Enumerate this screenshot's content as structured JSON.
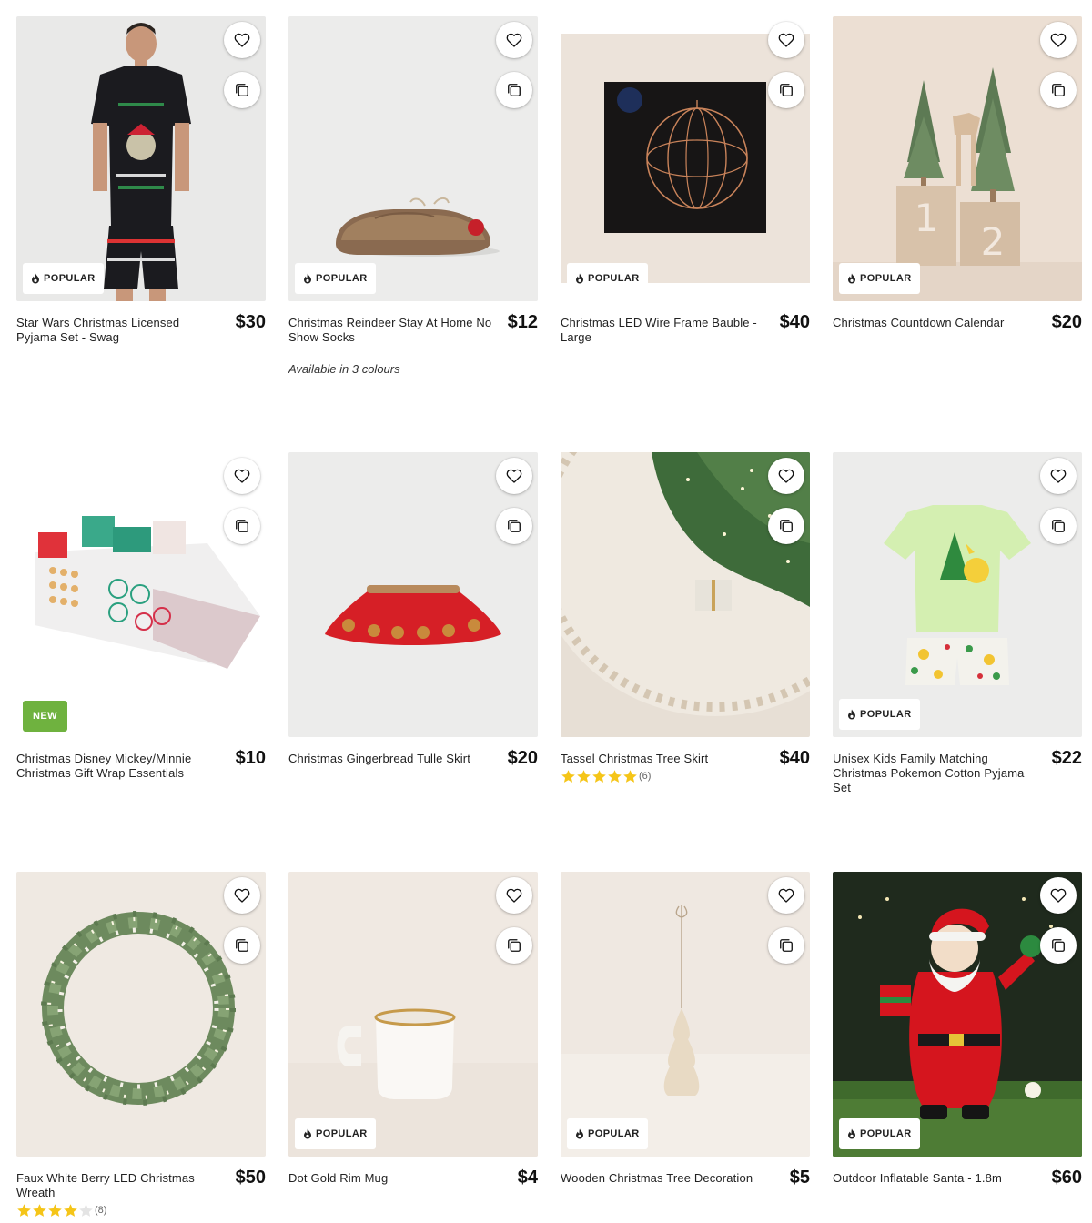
{
  "products": [
    {
      "name": "Star Wars Christmas Licensed Pyjama Set - Swag",
      "price": "$30",
      "badge": "POPULAR",
      "image": "man-christmas-pyjama"
    },
    {
      "name": "Christmas Reindeer Stay At Home No Show Socks",
      "price": "$12",
      "badge": "POPULAR",
      "note": "Available in 3 colours",
      "image": "reindeer-slipper-sock"
    },
    {
      "name": "Christmas LED Wire Frame Bauble - Large",
      "price": "$40",
      "badge": "POPULAR",
      "image": "led-wire-bauble-box"
    },
    {
      "name": "Christmas Countdown Calendar",
      "price": "$20",
      "badge": "POPULAR",
      "image": "wooden-countdown-blocks"
    },
    {
      "name": "Christmas Disney Mickey/Minnie Christmas Gift Wrap Essentials",
      "price": "$10",
      "badge": "NEW",
      "image": "gift-wrap-set"
    },
    {
      "name": "Christmas Gingerbread Tulle Skirt",
      "price": "$20",
      "image": "red-tulle-skirt"
    },
    {
      "name": "Tassel Christmas Tree Skirt",
      "price": "$40",
      "rating": 5,
      "review_count": "(6)",
      "image": "tree-skirt"
    },
    {
      "name": "Unisex Kids Family Matching Christmas Pokemon Cotton Pyjama Set",
      "price": "$22",
      "badge": "POPULAR",
      "image": "kids-pokemon-pyjama"
    },
    {
      "name": "Faux White Berry LED Christmas Wreath",
      "price": "$50",
      "rating": 4,
      "review_count": "(8)",
      "image": "berry-wreath"
    },
    {
      "name": "Dot Gold Rim Mug",
      "price": "$4",
      "badge": "POPULAR",
      "image": "gold-rim-mug"
    },
    {
      "name": "Wooden Christmas Tree Decoration",
      "price": "$5",
      "badge": "POPULAR",
      "image": "wooden-tree-ornament"
    },
    {
      "name": "Outdoor Inflatable Santa - 1.8m",
      "price": "$60",
      "badge": "POPULAR",
      "image": "inflatable-santa"
    }
  ],
  "icons": {
    "favourite": "heart-icon",
    "compare": "compare-icon",
    "popular": "flame-icon",
    "rating": "star-icon"
  },
  "colors": {
    "new_badge": "#6fb23f",
    "star": "#f5c518"
  }
}
